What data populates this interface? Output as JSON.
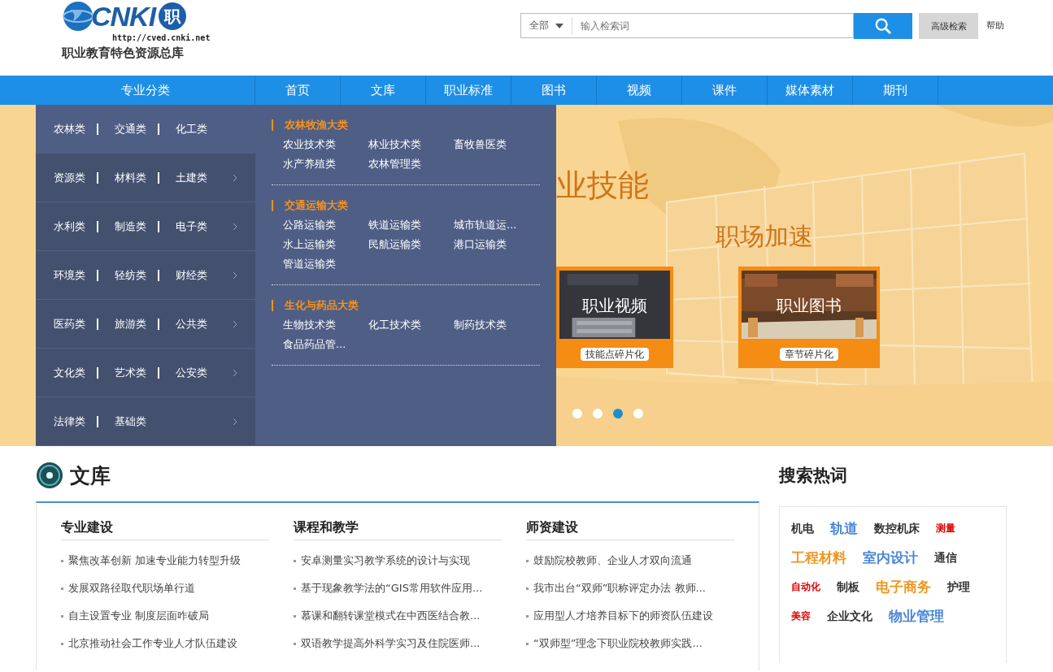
{
  "logo": {
    "wordmark": "CNKI",
    "badge": "职",
    "url": "http://cved.cnki.net",
    "subtitle": "职业教育特色资源总库"
  },
  "search": {
    "scope": "全部",
    "placeholder": "输入检索词",
    "advanced": "高级检索",
    "help": "帮助"
  },
  "nav": {
    "category_label": "专业分类",
    "items": [
      "首页",
      "文库",
      "职业标准",
      "图书",
      "视频",
      "课件",
      "媒体素材",
      "期刊"
    ]
  },
  "category_menu": {
    "rows": [
      {
        "selected": true,
        "items": [
          "农林类",
          "交通类",
          "化工类"
        ]
      },
      {
        "selected": false,
        "items": [
          "资源类",
          "材料类",
          "土建类"
        ]
      },
      {
        "selected": false,
        "items": [
          "水利类",
          "制造类",
          "电子类"
        ]
      },
      {
        "selected": false,
        "items": [
          "环境类",
          "轻纺类",
          "财经类"
        ]
      },
      {
        "selected": false,
        "items": [
          "医药类",
          "旅游类",
          "公共类"
        ]
      },
      {
        "selected": false,
        "items": [
          "文化类",
          "艺术类",
          "公安类"
        ]
      },
      {
        "selected": false,
        "items": [
          "法律类",
          "基础类"
        ]
      }
    ],
    "groups": [
      {
        "title": "农林牧渔大类",
        "items": [
          "农业技术类",
          "林业技术类",
          "畜牧兽医类",
          "水产养殖类",
          "农林管理类"
        ]
      },
      {
        "title": "交通运输大类",
        "items": [
          "公路运输类",
          "铁道运输类",
          "城市轨道运...",
          "水上运输类",
          "民航运输类",
          "港口运输类",
          "管道运输类"
        ]
      },
      {
        "title": "生化与药品大类",
        "items": [
          "生物技术类",
          "化工技术类",
          "制药技术类",
          "食品药品管..."
        ]
      }
    ]
  },
  "banner": {
    "headline": "业技能",
    "subhead": "职场加速",
    "cards": [
      {
        "title": "职业视频",
        "tag": "技能点碎片化"
      },
      {
        "title": "职业图书",
        "tag": "章节碎片化"
      }
    ],
    "dots": [
      {
        "selected": false
      },
      {
        "selected": false
      },
      {
        "selected": true
      },
      {
        "selected": false
      }
    ]
  },
  "library": {
    "title": "文库",
    "columns": [
      {
        "heading": "专业建设",
        "items": [
          "聚焦改革创新 加速专业能力转型升级",
          "发展双路径取代职场单行道",
          "自主设置专业 制度层面咋破局",
          "北京推动社会工作专业人才队伍建设"
        ]
      },
      {
        "heading": "课程和教学",
        "items": [
          "安卓测量实习教学系统的设计与实现",
          "基于现象教学法的“GIS常用软件应用...",
          "慕课和翻转课堂模式在中西医结合教...",
          "双语教学提高外科学实习及住院医师..."
        ]
      },
      {
        "heading": "师资建设",
        "items": [
          "鼓励院校教师、企业人才双向流通",
          "我市出台“双师”职称评定办法 教师...",
          "应用型人才培养目标下的师资队伍建设",
          "“双师型”理念下职业院校教师实践..."
        ]
      }
    ]
  },
  "hot_words": {
    "title": "搜索热词",
    "words": [
      {
        "text": "机电",
        "kind": "normal",
        "color": "#333333"
      },
      {
        "text": "轨道",
        "kind": "big",
        "color": "#4a86d6"
      },
      {
        "text": "数控机床",
        "kind": "normal",
        "color": "#333333"
      },
      {
        "text": "测量",
        "kind": "small",
        "color": "#dd0000"
      },
      {
        "text": "工程材料",
        "kind": "big",
        "color": "#f0961e"
      },
      {
        "text": "室内设计",
        "kind": "big",
        "color": "#4a86d6"
      },
      {
        "text": "通信",
        "kind": "normal",
        "color": "#333333"
      },
      {
        "text": "自动化",
        "kind": "small",
        "color": "#dd0000"
      },
      {
        "text": "制板",
        "kind": "normal",
        "color": "#333333"
      },
      {
        "text": "电子商务",
        "kind": "big",
        "color": "#f0961e"
      },
      {
        "text": "护理",
        "kind": "normal",
        "color": "#333333"
      },
      {
        "text": "美容",
        "kind": "small",
        "color": "#dd0000"
      },
      {
        "text": "企业文化",
        "kind": "normal",
        "color": "#333333"
      },
      {
        "text": "物业管理",
        "kind": "big",
        "color": "#4a86d6"
      }
    ]
  }
}
